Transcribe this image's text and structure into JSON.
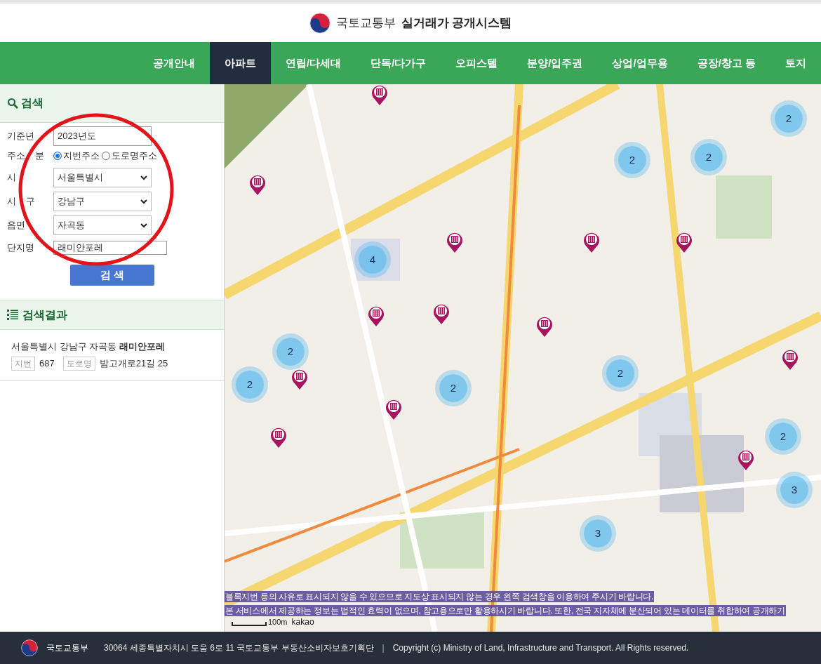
{
  "header": {
    "ministry": "국토교통부",
    "system": "실거래가 공개시스템"
  },
  "nav": [
    {
      "label": "공개안내",
      "selected": false
    },
    {
      "label": "아파트",
      "selected": true
    },
    {
      "label": "연립/다세대",
      "selected": false
    },
    {
      "label": "단독/다가구",
      "selected": false
    },
    {
      "label": "오피스텔",
      "selected": false
    },
    {
      "label": "분양/입주권",
      "selected": false
    },
    {
      "label": "상업/업무용",
      "selected": false
    },
    {
      "label": "공장/창고 등",
      "selected": false
    },
    {
      "label": "토지",
      "selected": false
    }
  ],
  "search": {
    "title": "검색",
    "fields": [
      {
        "kind": "text",
        "label": [
          "기준년"
        ],
        "value": "2023년도"
      },
      {
        "kind": "radio",
        "label": [
          "주소",
          "분"
        ],
        "options": [
          {
            "label": "지번주소",
            "selected": true
          },
          {
            "label": "도로명주소",
            "selected": false
          }
        ]
      },
      {
        "kind": "select",
        "label": [
          "시"
        ],
        "value": "서울특별시"
      },
      {
        "kind": "select",
        "label": [
          "시",
          "구"
        ],
        "value": "강남구"
      },
      {
        "kind": "select",
        "label": [
          "읍면"
        ],
        "value": "자곡동"
      },
      {
        "kind": "text",
        "label": [
          "단지명"
        ],
        "value": "래미안포레"
      }
    ],
    "button": "검 색"
  },
  "results": {
    "title": "검색결과",
    "items": [
      {
        "address": "서울특별시 강남구 자곡동 **래미안포레**",
        "lot_tag": "지번",
        "lot": "687",
        "road_tag": "도로명",
        "road": "밤고개로21길 25"
      }
    ]
  },
  "map": {
    "clusters": [
      "4",
      "2",
      "2",
      "2",
      "2",
      "2",
      "2",
      "2",
      "2",
      "3",
      "3"
    ],
    "notices": [
      "블록지번 등의 사유로 표시되지 않을 수 있으므로 지도상 표시되지 않는 경우 왼쪽 검색창을 이용하여 주시기 바랍니다.",
      "본 서비스에서 제공하는 정보는 법적인 효력이 없으며, 참고용으로만 활용하시기 바랍니다. 또한, 전국 지자체에 분산되어 있는 데이터를 취합하여 공개하기"
    ],
    "scale": "100m",
    "brand": "kakao"
  },
  "footer": {
    "ministry": "국토교통부",
    "address": "30064 세종특별자치시 도움 6로 11 국토교통부 부동산소비자보호기획단",
    "separator": "|",
    "copyright": "Copyright (c) Ministry of Land, Infrastructure and Transport. All Rights reserved."
  }
}
